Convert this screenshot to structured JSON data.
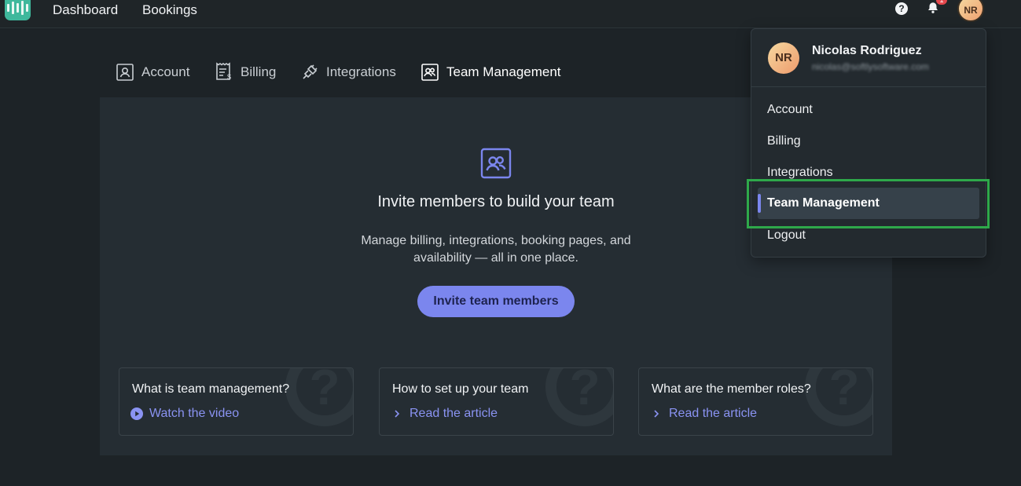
{
  "topbar": {
    "nav": [
      "Dashboard",
      "Bookings"
    ],
    "notification_count": "1",
    "avatar_initials": "NR"
  },
  "tabs": [
    {
      "label": "Account",
      "icon": "user-card-icon"
    },
    {
      "label": "Billing",
      "icon": "receipt-icon"
    },
    {
      "label": "Integrations",
      "icon": "plug-icon"
    },
    {
      "label": "Team Management",
      "icon": "team-icon",
      "active": true
    }
  ],
  "main": {
    "title": "Invite members to build your team",
    "subtitle": "Manage billing, integrations, booking pages, and availability — all in one place.",
    "cta": "Invite team members"
  },
  "cards": [
    {
      "title": "What is team management?",
      "link": "Watch the video",
      "icon": "play-icon"
    },
    {
      "title": "How to set up your team",
      "link": "Read the article",
      "icon": "chevron-right-icon"
    },
    {
      "title": "What are the member roles?",
      "link": "Read the article",
      "icon": "chevron-right-icon"
    }
  ],
  "dropdown": {
    "avatar_initials": "NR",
    "name": "Nicolas Rodriguez",
    "email": "nicolas@softlysoftware.com",
    "items": [
      "Account",
      "Billing",
      "Integrations",
      "Team Management",
      "Logout"
    ],
    "active_item": "Team Management"
  },
  "colors": {
    "accent": "#7b86ee",
    "highlight": "#2ea84a",
    "brand": "#3fb89c"
  }
}
